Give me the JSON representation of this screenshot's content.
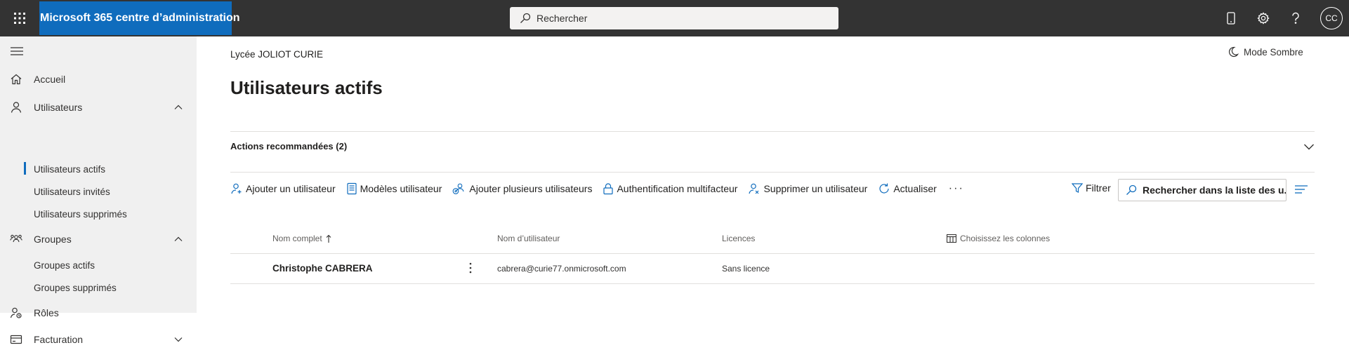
{
  "header": {
    "app_title": "Microsoft 365 centre d’administration",
    "search_placeholder": "Rechercher",
    "avatar_initials": "CC",
    "icons": [
      "app-launcher-icon",
      "search-icon",
      "mobile-icon",
      "gear-icon",
      "help-icon"
    ]
  },
  "sidebar": {
    "items": [
      {
        "label": "Accueil",
        "icon": "home-icon"
      },
      {
        "label": "Utilisateurs",
        "icon": "person-icon",
        "expanded": true,
        "children": [
          "Utilisateurs actifs",
          "Utilisateurs invités",
          "Utilisateurs supprimés"
        ]
      },
      {
        "label": "Groupes",
        "icon": "groups-icon",
        "expanded": true,
        "children": [
          "Groupes actifs",
          "Groupes supprimés"
        ]
      },
      {
        "label": "Rôles",
        "icon": "roles-icon"
      },
      {
        "label": "Facturation",
        "icon": "billing-icon",
        "expanded": false
      }
    ],
    "active_child": "Utilisateurs actifs"
  },
  "main": {
    "org_name": "Lycée JOLIOT CURIE",
    "dark_mode_label": "Mode Sombre",
    "page_title": "Utilisateurs actifs",
    "recommended_actions": "Actions recommandées (2)",
    "commands": [
      {
        "label": "Ajouter un utilisateur",
        "icon": "add-person-icon"
      },
      {
        "label": "Modèles utilisateur",
        "icon": "template-icon"
      },
      {
        "label": "Ajouter plusieurs utilisateurs",
        "icon": "add-people-icon"
      },
      {
        "label": "Authentification multifacteur",
        "icon": "lock-icon"
      },
      {
        "label": "Supprimer un utilisateur",
        "icon": "remove-person-icon"
      },
      {
        "label": "Actualiser",
        "icon": "refresh-icon"
      }
    ],
    "more_label": "···",
    "filter_label": "Filtrer",
    "list_search_placeholder": "Rechercher dans la liste des u...",
    "table": {
      "columns": [
        "Nom complet",
        "Nom d’utilisateur",
        "Licences",
        "Choisissez les colonnes"
      ],
      "sort_column": "Nom complet",
      "rows": [
        {
          "name": "Christophe CABRERA",
          "username": "cabrera@curie77.onmicrosoft.com",
          "licenses": "Sans licence"
        }
      ]
    }
  },
  "colors": {
    "topbar": "#333333",
    "brand": "#0f6cbd",
    "sidebar": "#f0f0f0",
    "accent": "#0f6cbd"
  }
}
